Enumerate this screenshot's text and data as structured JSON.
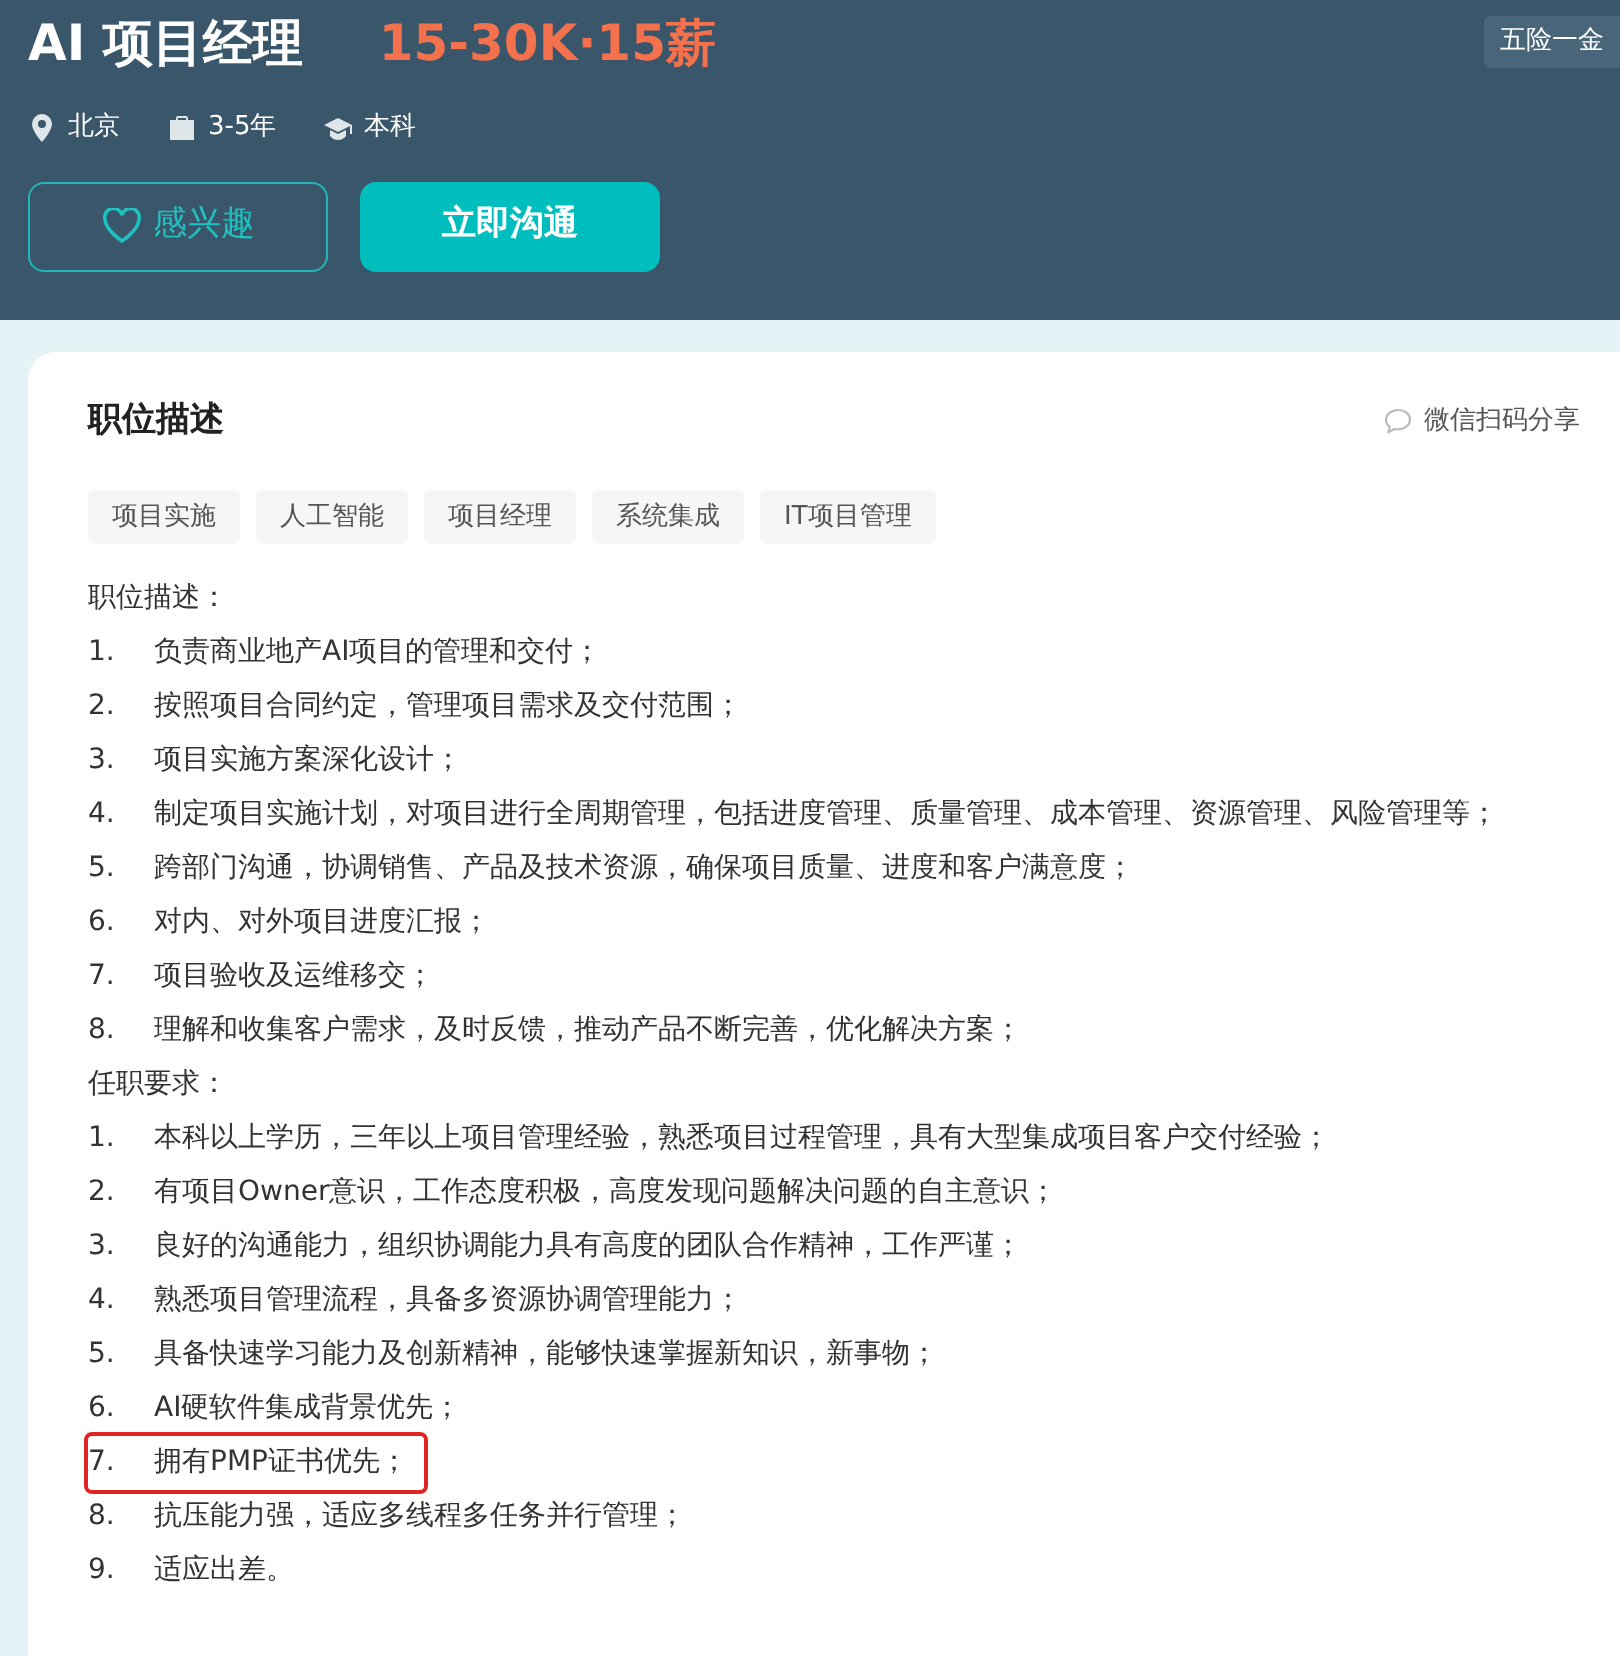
{
  "header": {
    "title": "AI 项目经理",
    "salary": "15-30K·15薪",
    "benefit_badge": "五险一金",
    "meta": [
      {
        "kind": "location",
        "text": "北京"
      },
      {
        "kind": "experience",
        "text": "3-5年"
      },
      {
        "kind": "education",
        "text": "本科"
      }
    ],
    "buttons": [
      {
        "kind": "outline",
        "label": "感兴趣"
      },
      {
        "kind": "primary",
        "label": "立即沟通"
      }
    ]
  },
  "card": {
    "title": "职位描述",
    "share": "微信扫码分享",
    "tags": [
      "项目实施",
      "人工智能",
      "项目经理",
      "系统集成",
      "IT项目管理"
    ],
    "sections": [
      {
        "heading": "职位描述：",
        "items": [
          {
            "number": "1.",
            "text": "负责商业地产AI项目的管理和交付；",
            "highlighted": false
          },
          {
            "number": "2.",
            "text": "按照项目合同约定，管理项目需求及交付范围；",
            "highlighted": false
          },
          {
            "number": "3.",
            "text": "项目实施方案深化设计；",
            "highlighted": false
          },
          {
            "number": "4.",
            "text": "制定项目实施计划，对项目进行全周期管理，包括进度管理、质量管理、成本管理、资源管理、风险管理等；",
            "highlighted": false
          },
          {
            "number": "5.",
            "text": "跨部门沟通，协调销售、产品及技术资源，确保项目质量、进度和客户满意度；",
            "highlighted": false
          },
          {
            "number": "6.",
            "text": "对内、对外项目进度汇报；",
            "highlighted": false
          },
          {
            "number": "7.",
            "text": "项目验收及运维移交；",
            "highlighted": false
          },
          {
            "number": "8.",
            "text": "理解和收集客户需求，及时反馈，推动产品不断完善，优化解决方案；",
            "highlighted": false
          }
        ]
      },
      {
        "heading": "任职要求：",
        "items": [
          {
            "number": "1.",
            "text": "本科以上学历，三年以上项目管理经验，熟悉项目过程管理，具有大型集成项目客户交付经验；",
            "highlighted": false
          },
          {
            "number": "2.",
            "text": "有项目Owner意识，工作态度积极，高度发现问题解决问题的自主意识；",
            "highlighted": false
          },
          {
            "number": "3.",
            "text": "良好的沟通能力，组织协调能力具有高度的团队合作精神，工作严谨；",
            "highlighted": false
          },
          {
            "number": "4.",
            "text": "熟悉项目管理流程，具备多资源协调管理能力；",
            "highlighted": false
          },
          {
            "number": "5.",
            "text": "具备快速学习能力及创新精神，能够快速掌握新知识，新事物；",
            "highlighted": false
          },
          {
            "number": "6.",
            "text": "AI硬软件集成背景优先；",
            "highlighted": false
          },
          {
            "number": "7.",
            "text": "拥有PMP证书优先；",
            "highlighted": true
          },
          {
            "number": "8.",
            "text": "抗压能力强，适应多线程多任务并行管理；",
            "highlighted": false
          },
          {
            "number": "9.",
            "text": "适应出差。",
            "highlighted": false
          }
        ]
      }
    ]
  }
}
